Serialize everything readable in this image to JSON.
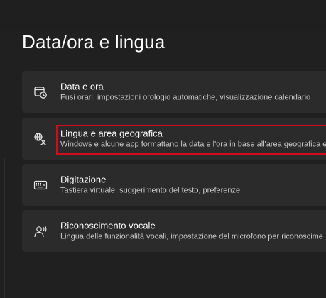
{
  "page": {
    "title": "Data/ora e lingua"
  },
  "settings": [
    {
      "icon": "clock-calendar-icon",
      "title": "Data e ora",
      "description": "Fusi orari, impostazioni orologio automatiche, visualizzazione calendario"
    },
    {
      "icon": "language-region-icon",
      "title": "Lingua e area geografica",
      "description": "Windows e alcune app formattano la data e l'ora in base all'area geografica e"
    },
    {
      "icon": "keyboard-icon",
      "title": "Digitazione",
      "description": "Tastiera virtuale, suggerimento del testo, preferenze"
    },
    {
      "icon": "voice-speech-icon",
      "title": "Riconoscimento vocale",
      "description": "Lingua delle funzionalità vocali, impostazione del microfono per riconoscime"
    }
  ],
  "colors": {
    "background": "#202020",
    "card": "#2b2b2b",
    "highlight": "#d40b1e"
  }
}
